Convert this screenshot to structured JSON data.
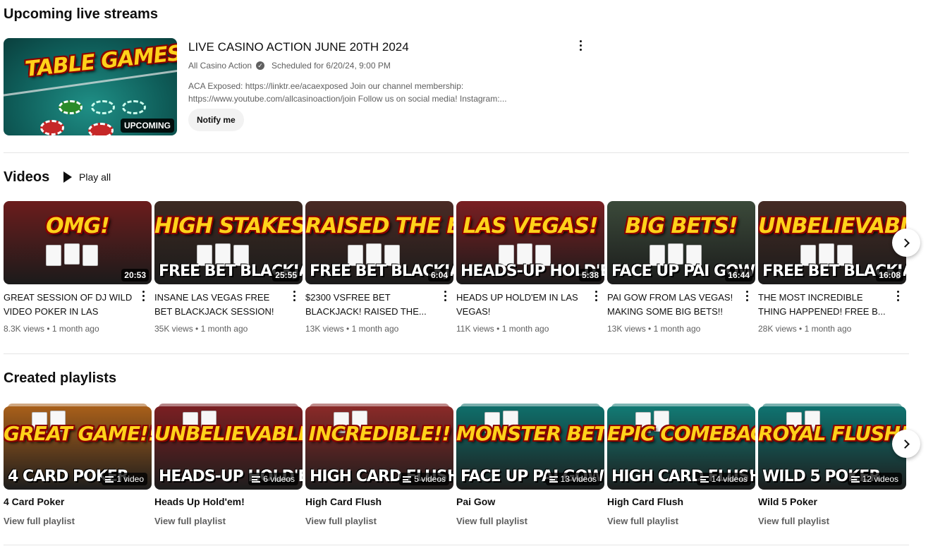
{
  "upcoming": {
    "heading": "Upcoming live streams",
    "thumb_text": "TABLE GAMES!?",
    "badge": "UPCOMING",
    "title": "LIVE CASINO ACTION JUNE 20TH 2024",
    "channel": "All Casino Action",
    "verified_icon": "✓",
    "scheduled": "Scheduled for 6/20/24, 9:00 PM",
    "description": "ACA Exposed: https://linktr.ee/acaexposed Join our channel membership: https://www.youtube.com/allcasinoaction/join Follow us on social media! Instagram:...",
    "notify_label": "Notify me"
  },
  "videos": {
    "heading": "Videos",
    "play_all": "Play all",
    "items": [
      {
        "top": "OMG!",
        "bottom": "",
        "duration": "20:53",
        "title": "GREAT SESSION OF DJ WILD VIDEO POKER IN LAS VEGAS!",
        "views": "8.3K views",
        "age": "1 month ago",
        "bg": "#6b1c1c"
      },
      {
        "top": "HIGH STAKES!",
        "bottom": "FREE BET BLACKJACK",
        "duration": "25:55",
        "title": "INSANE LAS VEGAS FREE BET BLACKJACK SESSION!",
        "views": "35K views",
        "age": "1 month ago",
        "bg": "#3d2a22"
      },
      {
        "top": "RAISED THE BET!",
        "bottom": "FREE BET BLACKJACK",
        "duration": "6:04",
        "title": "$2300 VSFREE BET BLACKJACK! RAISED THE...",
        "views": "13K views",
        "age": "1 month ago",
        "bg": "#4a2a24"
      },
      {
        "top": "LAS VEGAS!",
        "bottom": "HEADS-UP HOLD'EM",
        "duration": "5:38",
        "title": "HEADS UP HOLD'EM IN LAS VEGAS!",
        "views": "11K views",
        "age": "1 month ago",
        "bg": "#7a1f22"
      },
      {
        "top": "BIG BETS!",
        "bottom": "FACE UP PAI GOW POKER",
        "duration": "16:44",
        "title": "PAI GOW FROM LAS VEGAS! MAKING SOME BIG BETS!!",
        "views": "13K views",
        "age": "1 month ago",
        "bg": "#3b4a3a"
      },
      {
        "top": "UNBELIEVABLE!",
        "bottom": "FREE BET BLACKJACK",
        "duration": "16:08",
        "title": "THE MOST INCREDIBLE THING HAPPENED! FREE B...",
        "views": "28K views",
        "age": "1 month ago",
        "bg": "#452b24"
      }
    ]
  },
  "playlists": {
    "heading": "Created playlists",
    "link_label": "View full playlist",
    "items": [
      {
        "top": "GREAT GAME!!",
        "bottom": "4 CARD POKER",
        "count": "1 video",
        "title": "4 Card Poker",
        "bg": "#a85f1a"
      },
      {
        "top": "UNBELIEVABLE!!",
        "bottom": "HEADS-UP HOLD'EM",
        "count": "6 videos",
        "title": "Heads Up Hold'em!",
        "bg": "#7a1f22"
      },
      {
        "top": "INCREDIBLE!!",
        "bottom": "HIGH CARD FLUSH",
        "count": "5 videos",
        "title": "High Card Flush",
        "bg": "#8a2a28"
      },
      {
        "top": "MONSTER BETS!",
        "bottom": "FACE UP PAI GOW",
        "count": "13 videos",
        "title": "Pai Gow",
        "bg": "#0f6e6a"
      },
      {
        "top": "EPIC COMEBACK!?",
        "bottom": "HIGH CARD FLUSH",
        "count": "14 videos",
        "title": "High Card Flush",
        "bg": "#127a74"
      },
      {
        "top": "ROYAL FLUSH!",
        "bottom": "WILD 5 POKER",
        "count": "12 videos",
        "title": "Wild 5 Poker",
        "bg": "#0f7370"
      }
    ]
  },
  "colors": {
    "accent_yellow": "#ffd21a",
    "outline_red": "#8a0000",
    "meta_gray": "#606060"
  },
  "icons": {
    "next": "chevron-right-icon",
    "more": "more-vert-icon",
    "play": "play-icon",
    "playlist": "playlist-icon"
  }
}
